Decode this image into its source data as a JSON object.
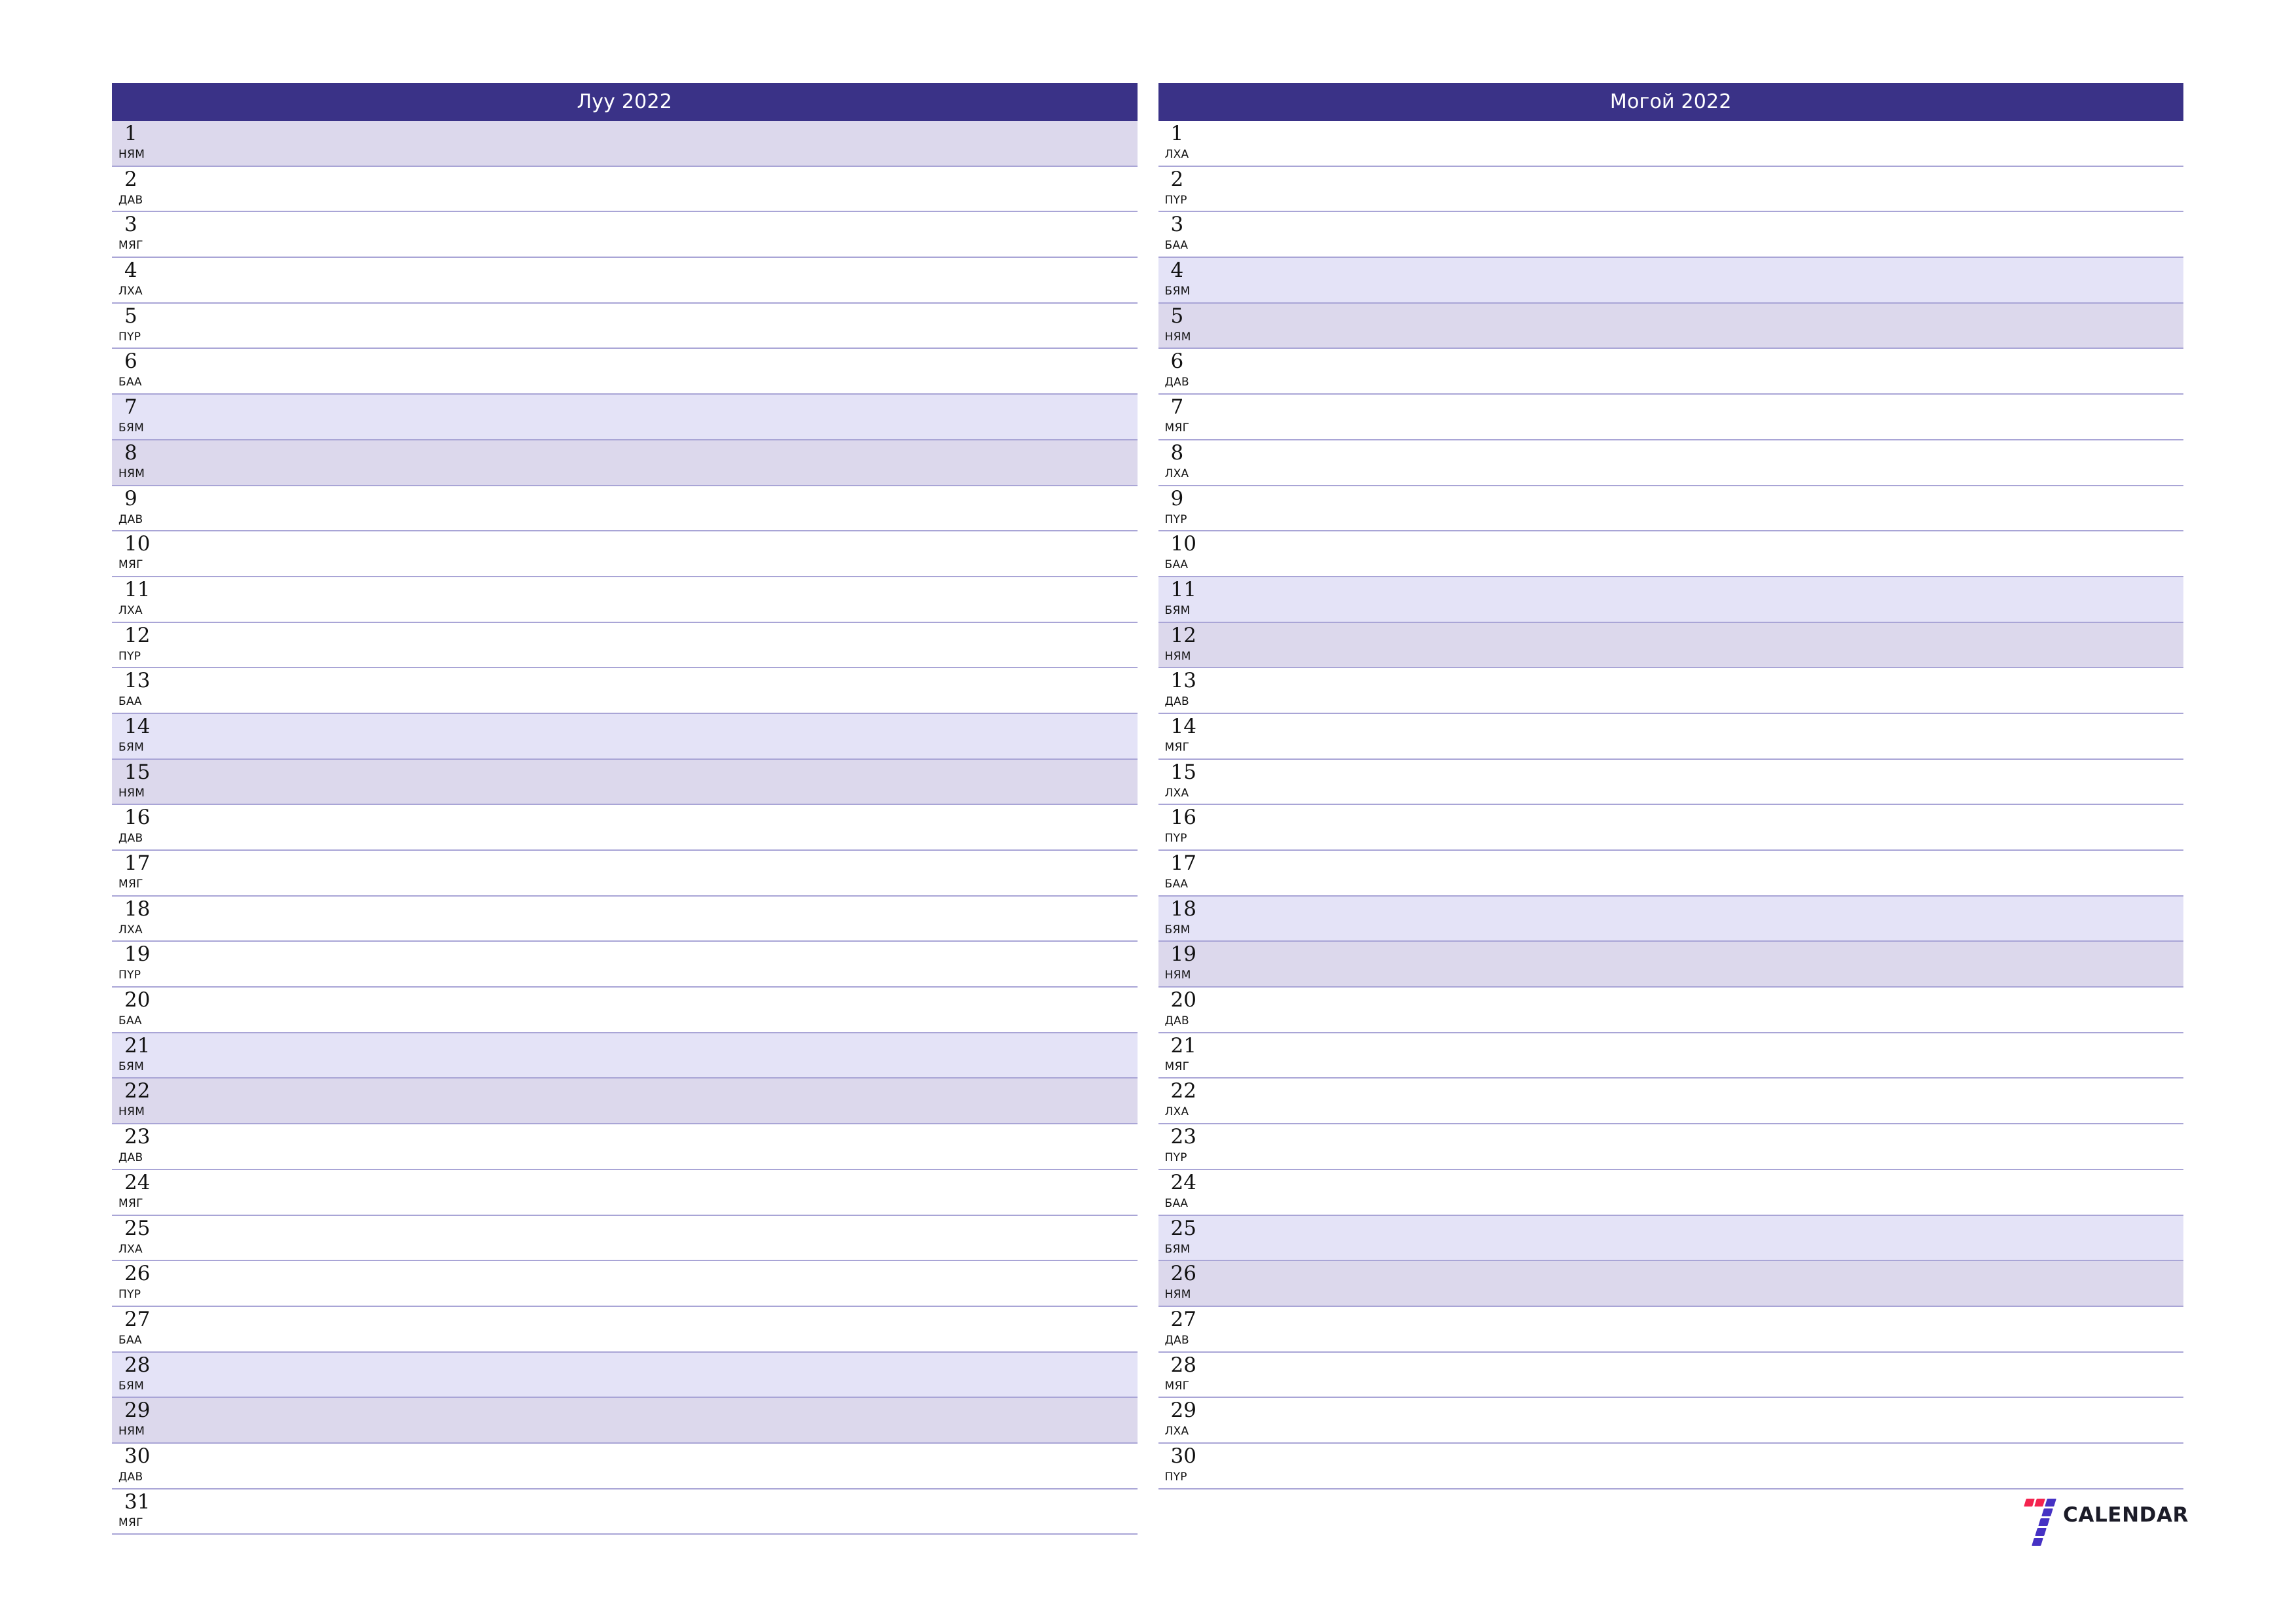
{
  "page": {
    "background_color": "#ffffff",
    "header_color": "#3a3287",
    "separator_color": "#a9a5d6",
    "saturday_color": "#e4e3f7",
    "sunday_color": "#dcd8ec"
  },
  "logo": {
    "wordmark": "CALENDAR",
    "mark_icon": "seven-logo-icon",
    "red": "#f4244f",
    "blue": "#4632c4"
  },
  "months": [
    {
      "title": "Луу 2022",
      "days": [
        {
          "num": "1",
          "abbr": "НЯМ",
          "type": "sun"
        },
        {
          "num": "2",
          "abbr": "ДАВ",
          "type": "weekday"
        },
        {
          "num": "3",
          "abbr": "МЯГ",
          "type": "weekday"
        },
        {
          "num": "4",
          "abbr": "ЛХА",
          "type": "weekday"
        },
        {
          "num": "5",
          "abbr": "ПҮР",
          "type": "weekday"
        },
        {
          "num": "6",
          "abbr": "БАА",
          "type": "weekday"
        },
        {
          "num": "7",
          "abbr": "БЯМ",
          "type": "sat"
        },
        {
          "num": "8",
          "abbr": "НЯМ",
          "type": "sun"
        },
        {
          "num": "9",
          "abbr": "ДАВ",
          "type": "weekday"
        },
        {
          "num": "10",
          "abbr": "МЯГ",
          "type": "weekday"
        },
        {
          "num": "11",
          "abbr": "ЛХА",
          "type": "weekday"
        },
        {
          "num": "12",
          "abbr": "ПҮР",
          "type": "weekday"
        },
        {
          "num": "13",
          "abbr": "БАА",
          "type": "weekday"
        },
        {
          "num": "14",
          "abbr": "БЯМ",
          "type": "sat"
        },
        {
          "num": "15",
          "abbr": "НЯМ",
          "type": "sun"
        },
        {
          "num": "16",
          "abbr": "ДАВ",
          "type": "weekday"
        },
        {
          "num": "17",
          "abbr": "МЯГ",
          "type": "weekday"
        },
        {
          "num": "18",
          "abbr": "ЛХА",
          "type": "weekday"
        },
        {
          "num": "19",
          "abbr": "ПҮР",
          "type": "weekday"
        },
        {
          "num": "20",
          "abbr": "БАА",
          "type": "weekday"
        },
        {
          "num": "21",
          "abbr": "БЯМ",
          "type": "sat"
        },
        {
          "num": "22",
          "abbr": "НЯМ",
          "type": "sun"
        },
        {
          "num": "23",
          "abbr": "ДАВ",
          "type": "weekday"
        },
        {
          "num": "24",
          "abbr": "МЯГ",
          "type": "weekday"
        },
        {
          "num": "25",
          "abbr": "ЛХА",
          "type": "weekday"
        },
        {
          "num": "26",
          "abbr": "ПҮР",
          "type": "weekday"
        },
        {
          "num": "27",
          "abbr": "БАА",
          "type": "weekday"
        },
        {
          "num": "28",
          "abbr": "БЯМ",
          "type": "sat"
        },
        {
          "num": "29",
          "abbr": "НЯМ",
          "type": "sun"
        },
        {
          "num": "30",
          "abbr": "ДАВ",
          "type": "weekday"
        },
        {
          "num": "31",
          "abbr": "МЯГ",
          "type": "weekday"
        }
      ]
    },
    {
      "title": "Могой 2022",
      "days": [
        {
          "num": "1",
          "abbr": "ЛХА",
          "type": "weekday"
        },
        {
          "num": "2",
          "abbr": "ПҮР",
          "type": "weekday"
        },
        {
          "num": "3",
          "abbr": "БАА",
          "type": "weekday"
        },
        {
          "num": "4",
          "abbr": "БЯМ",
          "type": "sat"
        },
        {
          "num": "5",
          "abbr": "НЯМ",
          "type": "sun"
        },
        {
          "num": "6",
          "abbr": "ДАВ",
          "type": "weekday"
        },
        {
          "num": "7",
          "abbr": "МЯГ",
          "type": "weekday"
        },
        {
          "num": "8",
          "abbr": "ЛХА",
          "type": "weekday"
        },
        {
          "num": "9",
          "abbr": "ПҮР",
          "type": "weekday"
        },
        {
          "num": "10",
          "abbr": "БАА",
          "type": "weekday"
        },
        {
          "num": "11",
          "abbr": "БЯМ",
          "type": "sat"
        },
        {
          "num": "12",
          "abbr": "НЯМ",
          "type": "sun"
        },
        {
          "num": "13",
          "abbr": "ДАВ",
          "type": "weekday"
        },
        {
          "num": "14",
          "abbr": "МЯГ",
          "type": "weekday"
        },
        {
          "num": "15",
          "abbr": "ЛХА",
          "type": "weekday"
        },
        {
          "num": "16",
          "abbr": "ПҮР",
          "type": "weekday"
        },
        {
          "num": "17",
          "abbr": "БАА",
          "type": "weekday"
        },
        {
          "num": "18",
          "abbr": "БЯМ",
          "type": "sat"
        },
        {
          "num": "19",
          "abbr": "НЯМ",
          "type": "sun"
        },
        {
          "num": "20",
          "abbr": "ДАВ",
          "type": "weekday"
        },
        {
          "num": "21",
          "abbr": "МЯГ",
          "type": "weekday"
        },
        {
          "num": "22",
          "abbr": "ЛХА",
          "type": "weekday"
        },
        {
          "num": "23",
          "abbr": "ПҮР",
          "type": "weekday"
        },
        {
          "num": "24",
          "abbr": "БАА",
          "type": "weekday"
        },
        {
          "num": "25",
          "abbr": "БЯМ",
          "type": "sat"
        },
        {
          "num": "26",
          "abbr": "НЯМ",
          "type": "sun"
        },
        {
          "num": "27",
          "abbr": "ДАВ",
          "type": "weekday"
        },
        {
          "num": "28",
          "abbr": "МЯГ",
          "type": "weekday"
        },
        {
          "num": "29",
          "abbr": "ЛХА",
          "type": "weekday"
        },
        {
          "num": "30",
          "abbr": "ПҮР",
          "type": "weekday"
        }
      ]
    }
  ]
}
